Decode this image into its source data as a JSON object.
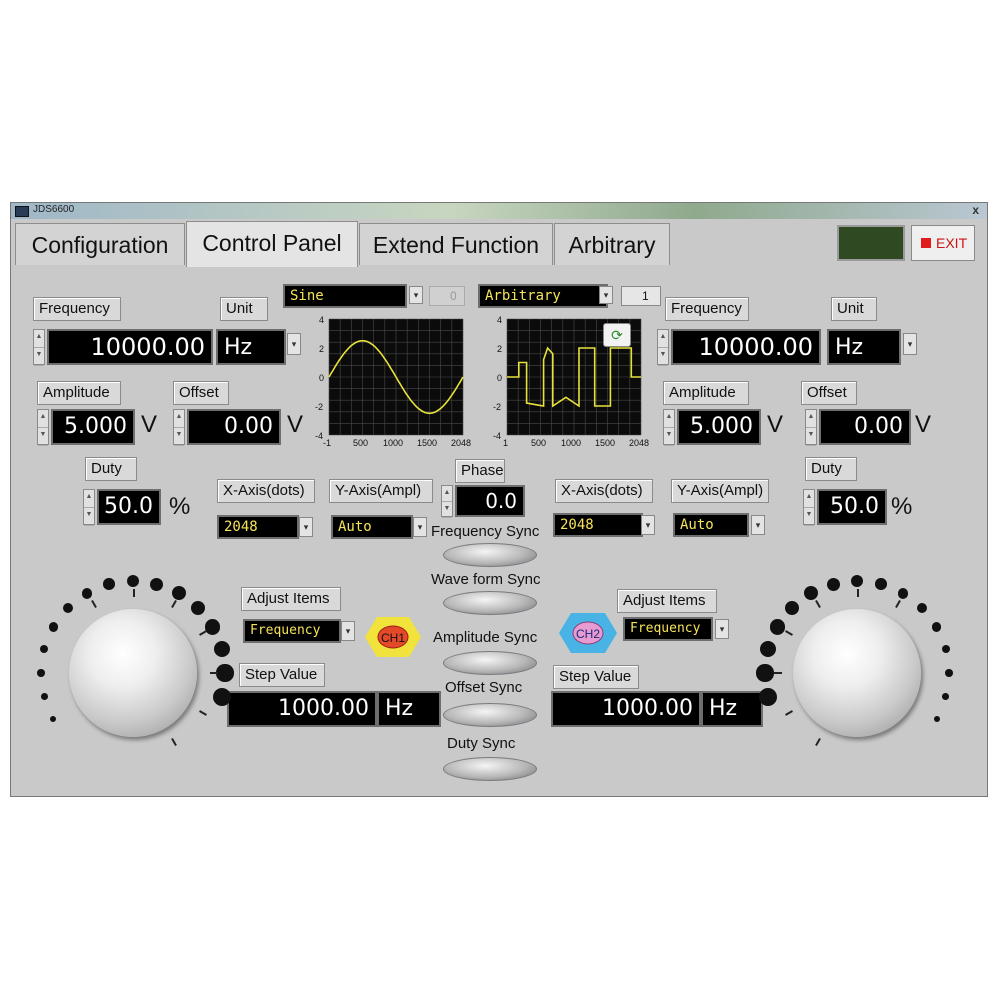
{
  "window": {
    "title": "JDS6600",
    "close": "x"
  },
  "tabs": [
    {
      "label": "Configuration"
    },
    {
      "label": "Control Panel"
    },
    {
      "label": "Extend Function"
    },
    {
      "label": "Arbitrary"
    }
  ],
  "exit_label": "EXIT",
  "status_indicator_color": "#2f4a22",
  "ch1": {
    "frequency_label": "Frequency",
    "frequency_value": "10000.00",
    "unit_label": "Unit",
    "unit_value": "Hz",
    "amplitude_label": "Amplitude",
    "amplitude_value": "5.000",
    "amplitude_unit": "V",
    "offset_label": "Offset",
    "offset_value": "0.00",
    "offset_unit": "V",
    "duty_label": "Duty",
    "duty_value": "50.0",
    "duty_unit": "%",
    "waveform": "Sine",
    "wave_index": "0",
    "xaxis_label": "X-Axis(dots)",
    "xaxis_value": "2048",
    "yaxis_label": "Y-Axis(Ampl)",
    "yaxis_value": "Auto",
    "adjust_label": "Adjust Items",
    "adjust_value": "Frequency",
    "badge": "CH1",
    "step_label": "Step Value",
    "step_value": "1000.00",
    "step_unit": "Hz"
  },
  "ch2": {
    "frequency_label": "Frequency",
    "frequency_value": "10000.00",
    "unit_label": "Unit",
    "unit_value": "Hz",
    "amplitude_label": "Amplitude",
    "amplitude_value": "5.000",
    "amplitude_unit": "V",
    "offset_label": "Offset",
    "offset_value": "0.00",
    "offset_unit": "V",
    "duty_label": "Duty",
    "duty_value": "50.0",
    "duty_unit": "%",
    "waveform": "Arbitrary",
    "wave_index": "1",
    "xaxis_label": "X-Axis(dots)",
    "xaxis_value": "2048",
    "yaxis_label": "Y-Axis(Ampl)",
    "yaxis_value": "Auto",
    "adjust_label": "Adjust Items",
    "adjust_value": "Frequency",
    "badge": "CH2",
    "step_label": "Step Value",
    "step_value": "1000.00",
    "step_unit": "Hz"
  },
  "phase": {
    "label": "Phase",
    "value": "0.0"
  },
  "sync": {
    "frequency": "Frequency Sync",
    "waveform": "Wave form Sync",
    "amplitude": "Amplitude Sync",
    "offset": "Offset Sync",
    "duty": "Duty  Sync"
  },
  "plot_axes": {
    "y_ticks": [
      "4",
      "2",
      "0",
      "-2",
      "-4"
    ],
    "x_ticks": [
      "-1",
      "500",
      "1000",
      "1500",
      "2048"
    ],
    "x_ticks_ch2": [
      "1",
      "500",
      "1000",
      "1500",
      "2048"
    ]
  },
  "colors": {
    "trace": "#e6e23a",
    "lcd_bg": "#000000",
    "lcd_text": "#ffffff",
    "dropdown_text": "#f6e35a",
    "ch1_badge": "#f2e33c",
    "ch2_badge": "#49b3e6"
  }
}
